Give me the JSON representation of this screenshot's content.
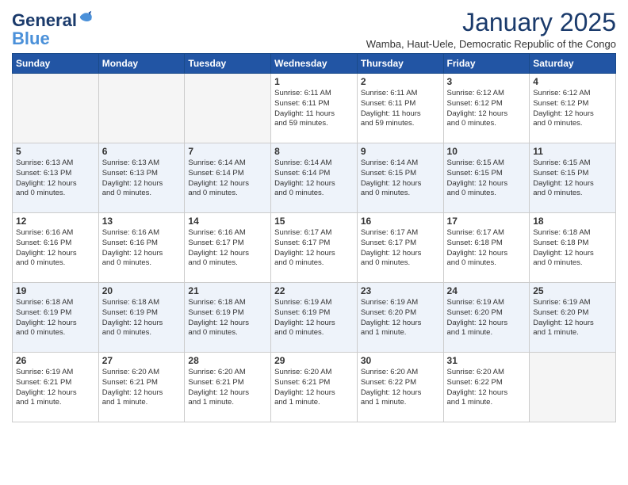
{
  "logo": {
    "line1": "General",
    "line2": "Blue"
  },
  "title": "January 2025",
  "subtitle": "Wamba, Haut-Uele, Democratic Republic of the Congo",
  "days_of_week": [
    "Sunday",
    "Monday",
    "Tuesday",
    "Wednesday",
    "Thursday",
    "Friday",
    "Saturday"
  ],
  "weeks": [
    [
      {
        "num": "",
        "info": "",
        "empty": true
      },
      {
        "num": "",
        "info": "",
        "empty": true
      },
      {
        "num": "",
        "info": "",
        "empty": true
      },
      {
        "num": "1",
        "info": "Sunrise: 6:11 AM\nSunset: 6:11 PM\nDaylight: 11 hours\nand 59 minutes.",
        "empty": false
      },
      {
        "num": "2",
        "info": "Sunrise: 6:11 AM\nSunset: 6:11 PM\nDaylight: 11 hours\nand 59 minutes.",
        "empty": false
      },
      {
        "num": "3",
        "info": "Sunrise: 6:12 AM\nSunset: 6:12 PM\nDaylight: 12 hours\nand 0 minutes.",
        "empty": false
      },
      {
        "num": "4",
        "info": "Sunrise: 6:12 AM\nSunset: 6:12 PM\nDaylight: 12 hours\nand 0 minutes.",
        "empty": false
      }
    ],
    [
      {
        "num": "5",
        "info": "Sunrise: 6:13 AM\nSunset: 6:13 PM\nDaylight: 12 hours\nand 0 minutes.",
        "empty": false
      },
      {
        "num": "6",
        "info": "Sunrise: 6:13 AM\nSunset: 6:13 PM\nDaylight: 12 hours\nand 0 minutes.",
        "empty": false
      },
      {
        "num": "7",
        "info": "Sunrise: 6:14 AM\nSunset: 6:14 PM\nDaylight: 12 hours\nand 0 minutes.",
        "empty": false
      },
      {
        "num": "8",
        "info": "Sunrise: 6:14 AM\nSunset: 6:14 PM\nDaylight: 12 hours\nand 0 minutes.",
        "empty": false
      },
      {
        "num": "9",
        "info": "Sunrise: 6:14 AM\nSunset: 6:15 PM\nDaylight: 12 hours\nand 0 minutes.",
        "empty": false
      },
      {
        "num": "10",
        "info": "Sunrise: 6:15 AM\nSunset: 6:15 PM\nDaylight: 12 hours\nand 0 minutes.",
        "empty": false
      },
      {
        "num": "11",
        "info": "Sunrise: 6:15 AM\nSunset: 6:15 PM\nDaylight: 12 hours\nand 0 minutes.",
        "empty": false
      }
    ],
    [
      {
        "num": "12",
        "info": "Sunrise: 6:16 AM\nSunset: 6:16 PM\nDaylight: 12 hours\nand 0 minutes.",
        "empty": false
      },
      {
        "num": "13",
        "info": "Sunrise: 6:16 AM\nSunset: 6:16 PM\nDaylight: 12 hours\nand 0 minutes.",
        "empty": false
      },
      {
        "num": "14",
        "info": "Sunrise: 6:16 AM\nSunset: 6:17 PM\nDaylight: 12 hours\nand 0 minutes.",
        "empty": false
      },
      {
        "num": "15",
        "info": "Sunrise: 6:17 AM\nSunset: 6:17 PM\nDaylight: 12 hours\nand 0 minutes.",
        "empty": false
      },
      {
        "num": "16",
        "info": "Sunrise: 6:17 AM\nSunset: 6:17 PM\nDaylight: 12 hours\nand 0 minutes.",
        "empty": false
      },
      {
        "num": "17",
        "info": "Sunrise: 6:17 AM\nSunset: 6:18 PM\nDaylight: 12 hours\nand 0 minutes.",
        "empty": false
      },
      {
        "num": "18",
        "info": "Sunrise: 6:18 AM\nSunset: 6:18 PM\nDaylight: 12 hours\nand 0 minutes.",
        "empty": false
      }
    ],
    [
      {
        "num": "19",
        "info": "Sunrise: 6:18 AM\nSunset: 6:19 PM\nDaylight: 12 hours\nand 0 minutes.",
        "empty": false
      },
      {
        "num": "20",
        "info": "Sunrise: 6:18 AM\nSunset: 6:19 PM\nDaylight: 12 hours\nand 0 minutes.",
        "empty": false
      },
      {
        "num": "21",
        "info": "Sunrise: 6:18 AM\nSunset: 6:19 PM\nDaylight: 12 hours\nand 0 minutes.",
        "empty": false
      },
      {
        "num": "22",
        "info": "Sunrise: 6:19 AM\nSunset: 6:19 PM\nDaylight: 12 hours\nand 0 minutes.",
        "empty": false
      },
      {
        "num": "23",
        "info": "Sunrise: 6:19 AM\nSunset: 6:20 PM\nDaylight: 12 hours\nand 1 minute.",
        "empty": false
      },
      {
        "num": "24",
        "info": "Sunrise: 6:19 AM\nSunset: 6:20 PM\nDaylight: 12 hours\nand 1 minute.",
        "empty": false
      },
      {
        "num": "25",
        "info": "Sunrise: 6:19 AM\nSunset: 6:20 PM\nDaylight: 12 hours\nand 1 minute.",
        "empty": false
      }
    ],
    [
      {
        "num": "26",
        "info": "Sunrise: 6:19 AM\nSunset: 6:21 PM\nDaylight: 12 hours\nand 1 minute.",
        "empty": false
      },
      {
        "num": "27",
        "info": "Sunrise: 6:20 AM\nSunset: 6:21 PM\nDaylight: 12 hours\nand 1 minute.",
        "empty": false
      },
      {
        "num": "28",
        "info": "Sunrise: 6:20 AM\nSunset: 6:21 PM\nDaylight: 12 hours\nand 1 minute.",
        "empty": false
      },
      {
        "num": "29",
        "info": "Sunrise: 6:20 AM\nSunset: 6:21 PM\nDaylight: 12 hours\nand 1 minute.",
        "empty": false
      },
      {
        "num": "30",
        "info": "Sunrise: 6:20 AM\nSunset: 6:22 PM\nDaylight: 12 hours\nand 1 minute.",
        "empty": false
      },
      {
        "num": "31",
        "info": "Sunrise: 6:20 AM\nSunset: 6:22 PM\nDaylight: 12 hours\nand 1 minute.",
        "empty": false
      },
      {
        "num": "",
        "info": "",
        "empty": true
      }
    ]
  ]
}
